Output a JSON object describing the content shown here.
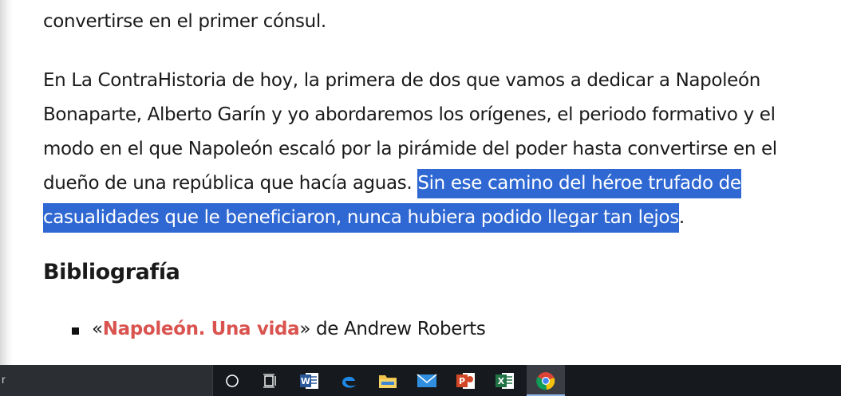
{
  "article": {
    "line_top": "convertirse en el primer cónsul.",
    "paragraph": {
      "line1": "En La ContraHistoria de hoy, la primera de dos que vamos a dedicar a Napoleón",
      "line2": "Bonaparte, Alberto Garín y yo abordaremos los orígenes, el periodo formativo y el",
      "line3": "modo en el que Napoleón escaló por la pirámide del poder hasta convertirse en el",
      "line4_plain": "dueño de una república que hacía aguas. ",
      "line4_selected": "Sin ese camino del héroe trufado de",
      "line5_selected": "casualidades que le beneficiaron, nunca hubiera podido llegar tan lejos",
      "line5_end": "."
    },
    "heading": "Bibliografía",
    "bibliography": [
      {
        "open_quote": "«",
        "title": "Napoleón. Una vida",
        "close_quote": "»",
        "rest": " de Andrew Roberts"
      }
    ]
  },
  "taskbar": {
    "search_text": "r",
    "icons": [
      "cortana-circle-icon",
      "task-view-icon",
      "word-icon",
      "edge-icon",
      "file-explorer-icon",
      "mail-icon",
      "powerpoint-icon",
      "excel-icon",
      "chrome-icon"
    ],
    "colors": {
      "selection": "#2f68d2",
      "link": "#d9534f",
      "taskbar": "#161a1e"
    }
  }
}
